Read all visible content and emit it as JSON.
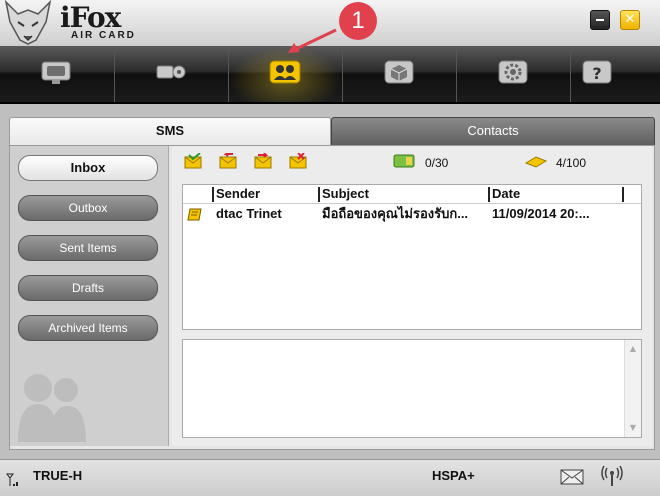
{
  "app": {
    "brand": "iFox",
    "brand_sub": "AIR CARD"
  },
  "window": {
    "minimize": "minimize",
    "close": "✕"
  },
  "toolbar": {
    "items": [
      {
        "icon": "monitor-icon"
      },
      {
        "icon": "key-icon"
      },
      {
        "icon": "contacts-icon",
        "active": true
      },
      {
        "icon": "box-icon"
      },
      {
        "icon": "gear-icon"
      },
      {
        "icon": "help-icon"
      }
    ]
  },
  "annotation": {
    "number": "1"
  },
  "tabs": {
    "sms": "SMS",
    "contacts": "Contacts"
  },
  "sidebar": {
    "items": [
      {
        "label": "Inbox",
        "selected": true
      },
      {
        "label": "Outbox"
      },
      {
        "label": "Sent Items"
      },
      {
        "label": "Drafts"
      },
      {
        "label": "Archived Items"
      }
    ]
  },
  "message_toolbar": {
    "icons": [
      "new-message-icon",
      "reply-icon",
      "forward-icon",
      "delete-message-icon"
    ],
    "sim_count": "0/30",
    "device_count": "4/100"
  },
  "table": {
    "columns": [
      "Sender",
      "Subject",
      "Date"
    ],
    "rows": [
      {
        "sender": "dtac Trinet",
        "subject": "มือถือของคุณไม่รองรับก...",
        "date": "11/09/2014 20:..."
      }
    ]
  },
  "status": {
    "operator": "TRUE-H",
    "network": "HSPA+"
  },
  "colors": {
    "accent_yellow": "#f5c400",
    "callout_red": "#e0414d",
    "toolbar_dark": "#1a1a1a"
  }
}
